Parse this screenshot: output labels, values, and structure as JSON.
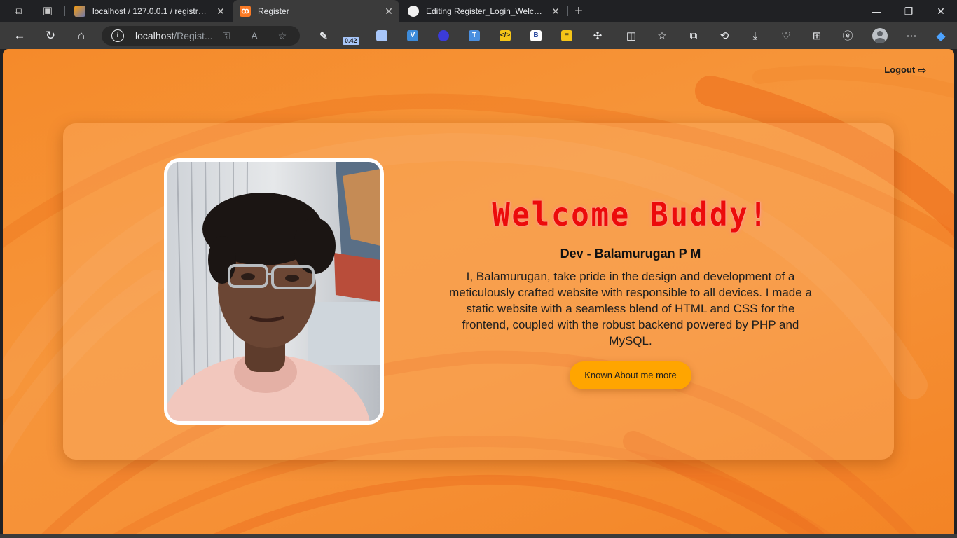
{
  "browser": {
    "tabs": [
      {
        "label": "localhost / 127.0.0.1 / registration",
        "favicon": "phpmyadmin-icon",
        "active": false
      },
      {
        "label": "Register",
        "favicon": "xampp-icon",
        "active": true
      },
      {
        "label": "Editing Register_Login_Welcome/",
        "favicon": "github-icon",
        "active": false
      }
    ],
    "address": {
      "host": "localhost",
      "path": "/Regist..."
    },
    "extension_badge": "0.42"
  },
  "page": {
    "logout_label": "Logout",
    "welcome_title": "Welcome Buddy!",
    "name": "Dev - Balamurugan P M",
    "bio": "I, Balamurugan, take pride in the design and development of a meticulously crafted website with responsible to all devices. I made a static website with a seamless blend of HTML and CSS for the frontend, coupled with the robust backend powered by PHP and MySQL.",
    "more_button": "Known About me more"
  },
  "colors": {
    "background": "#f6953a",
    "title": "#ec0b0b",
    "button": "#ffa500"
  }
}
